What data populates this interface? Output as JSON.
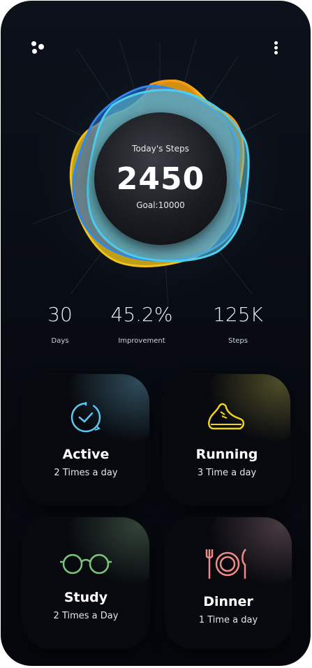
{
  "header": {
    "menu_icon": "dots-menu-icon",
    "more_icon": "vertical-dots-icon"
  },
  "steps": {
    "label": "Today's Steps",
    "value": "2450",
    "goal": "Goal:10000"
  },
  "stats": [
    {
      "value": "30",
      "label": "Days"
    },
    {
      "value": "45.2%",
      "label": "Improvement"
    },
    {
      "value": "125K",
      "label": "Steps"
    }
  ],
  "cards": [
    {
      "title": "Active",
      "subtitle": "2 Times a day",
      "icon": "clock-check-icon",
      "color": "#5bc8f2"
    },
    {
      "title": "Running",
      "subtitle": "3 Time a day",
      "icon": "shoe-icon",
      "color": "#f2d51a"
    },
    {
      "title": "Study",
      "subtitle": "2 Times a Day",
      "icon": "glasses-icon",
      "color": "#7cc67a"
    },
    {
      "title": "Dinner",
      "subtitle": "1 Time a day",
      "icon": "plate-cutlery-icon",
      "color": "#f08a86"
    }
  ],
  "colors": {
    "blob_yellow": "#f0c21b",
    "blob_orange": "#f59a14",
    "blob_blue": "#2a7fe0",
    "blob_cyan": "#4ccbe6"
  }
}
